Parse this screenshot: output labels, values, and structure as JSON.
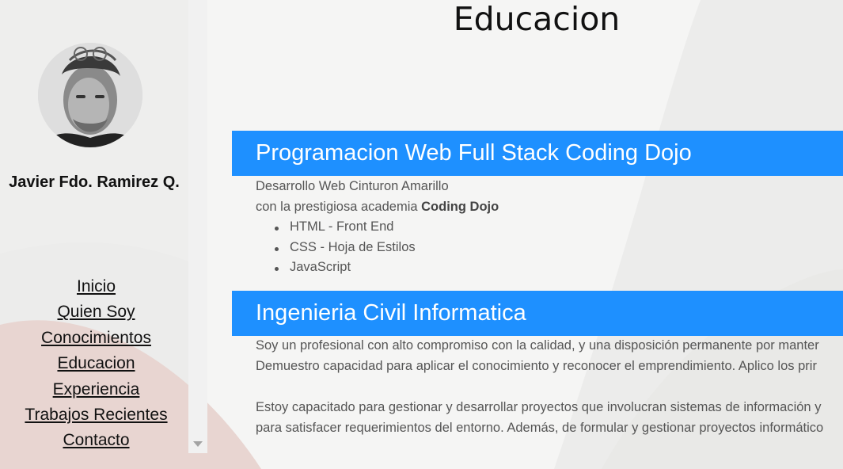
{
  "profile": {
    "name": "Javier Fdo. Ramirez Q."
  },
  "nav": {
    "items": [
      {
        "label": "Inicio",
        "name": "nav-link-inicio"
      },
      {
        "label": "Quien Soy",
        "name": "nav-link-quien-soy"
      },
      {
        "label": "Conocimientos",
        "name": "nav-link-conocimientos"
      },
      {
        "label": "Educacion",
        "name": "nav-link-educacion"
      },
      {
        "label": "Experiencia",
        "name": "nav-link-experiencia"
      },
      {
        "label": "Trabajos Recientes",
        "name": "nav-link-trabajos-recientes"
      },
      {
        "label": "Contacto",
        "name": "nav-link-contacto"
      }
    ]
  },
  "page": {
    "title": "Educacion"
  },
  "education": [
    {
      "heading": "Programacion Web Full Stack Coding Dojo",
      "line1": "Desarrollo Web Cinturon Amarillo",
      "line2_prefix": "con la prestigiosa academia ",
      "line2_bold": "Coding Dojo",
      "bullets": [
        "HTML - Front End",
        "CSS - Hoja de Estilos",
        "JavaScript"
      ]
    },
    {
      "heading": "Ingenieria Civil Informatica",
      "paragraphs": [
        "Soy un profesional con alto compromiso con la calidad, y una disposición permanente por manter",
        "Demuestro capacidad para aplicar el conocimiento y reconocer el emprendimiento. Aplico los prir",
        "Estoy capacitado para gestionar y desarrollar proyectos que involucran sistemas de información y",
        "para satisfacer requerimientos del entorno. Además, de formular y gestionar proyectos informático"
      ]
    }
  ],
  "colors": {
    "accent": "#1e90ff",
    "background": "#ececeb",
    "blob": "#f4f4f3",
    "pink": "#e8d3cf"
  },
  "icons": {
    "scroll_down": "triangle-down"
  }
}
